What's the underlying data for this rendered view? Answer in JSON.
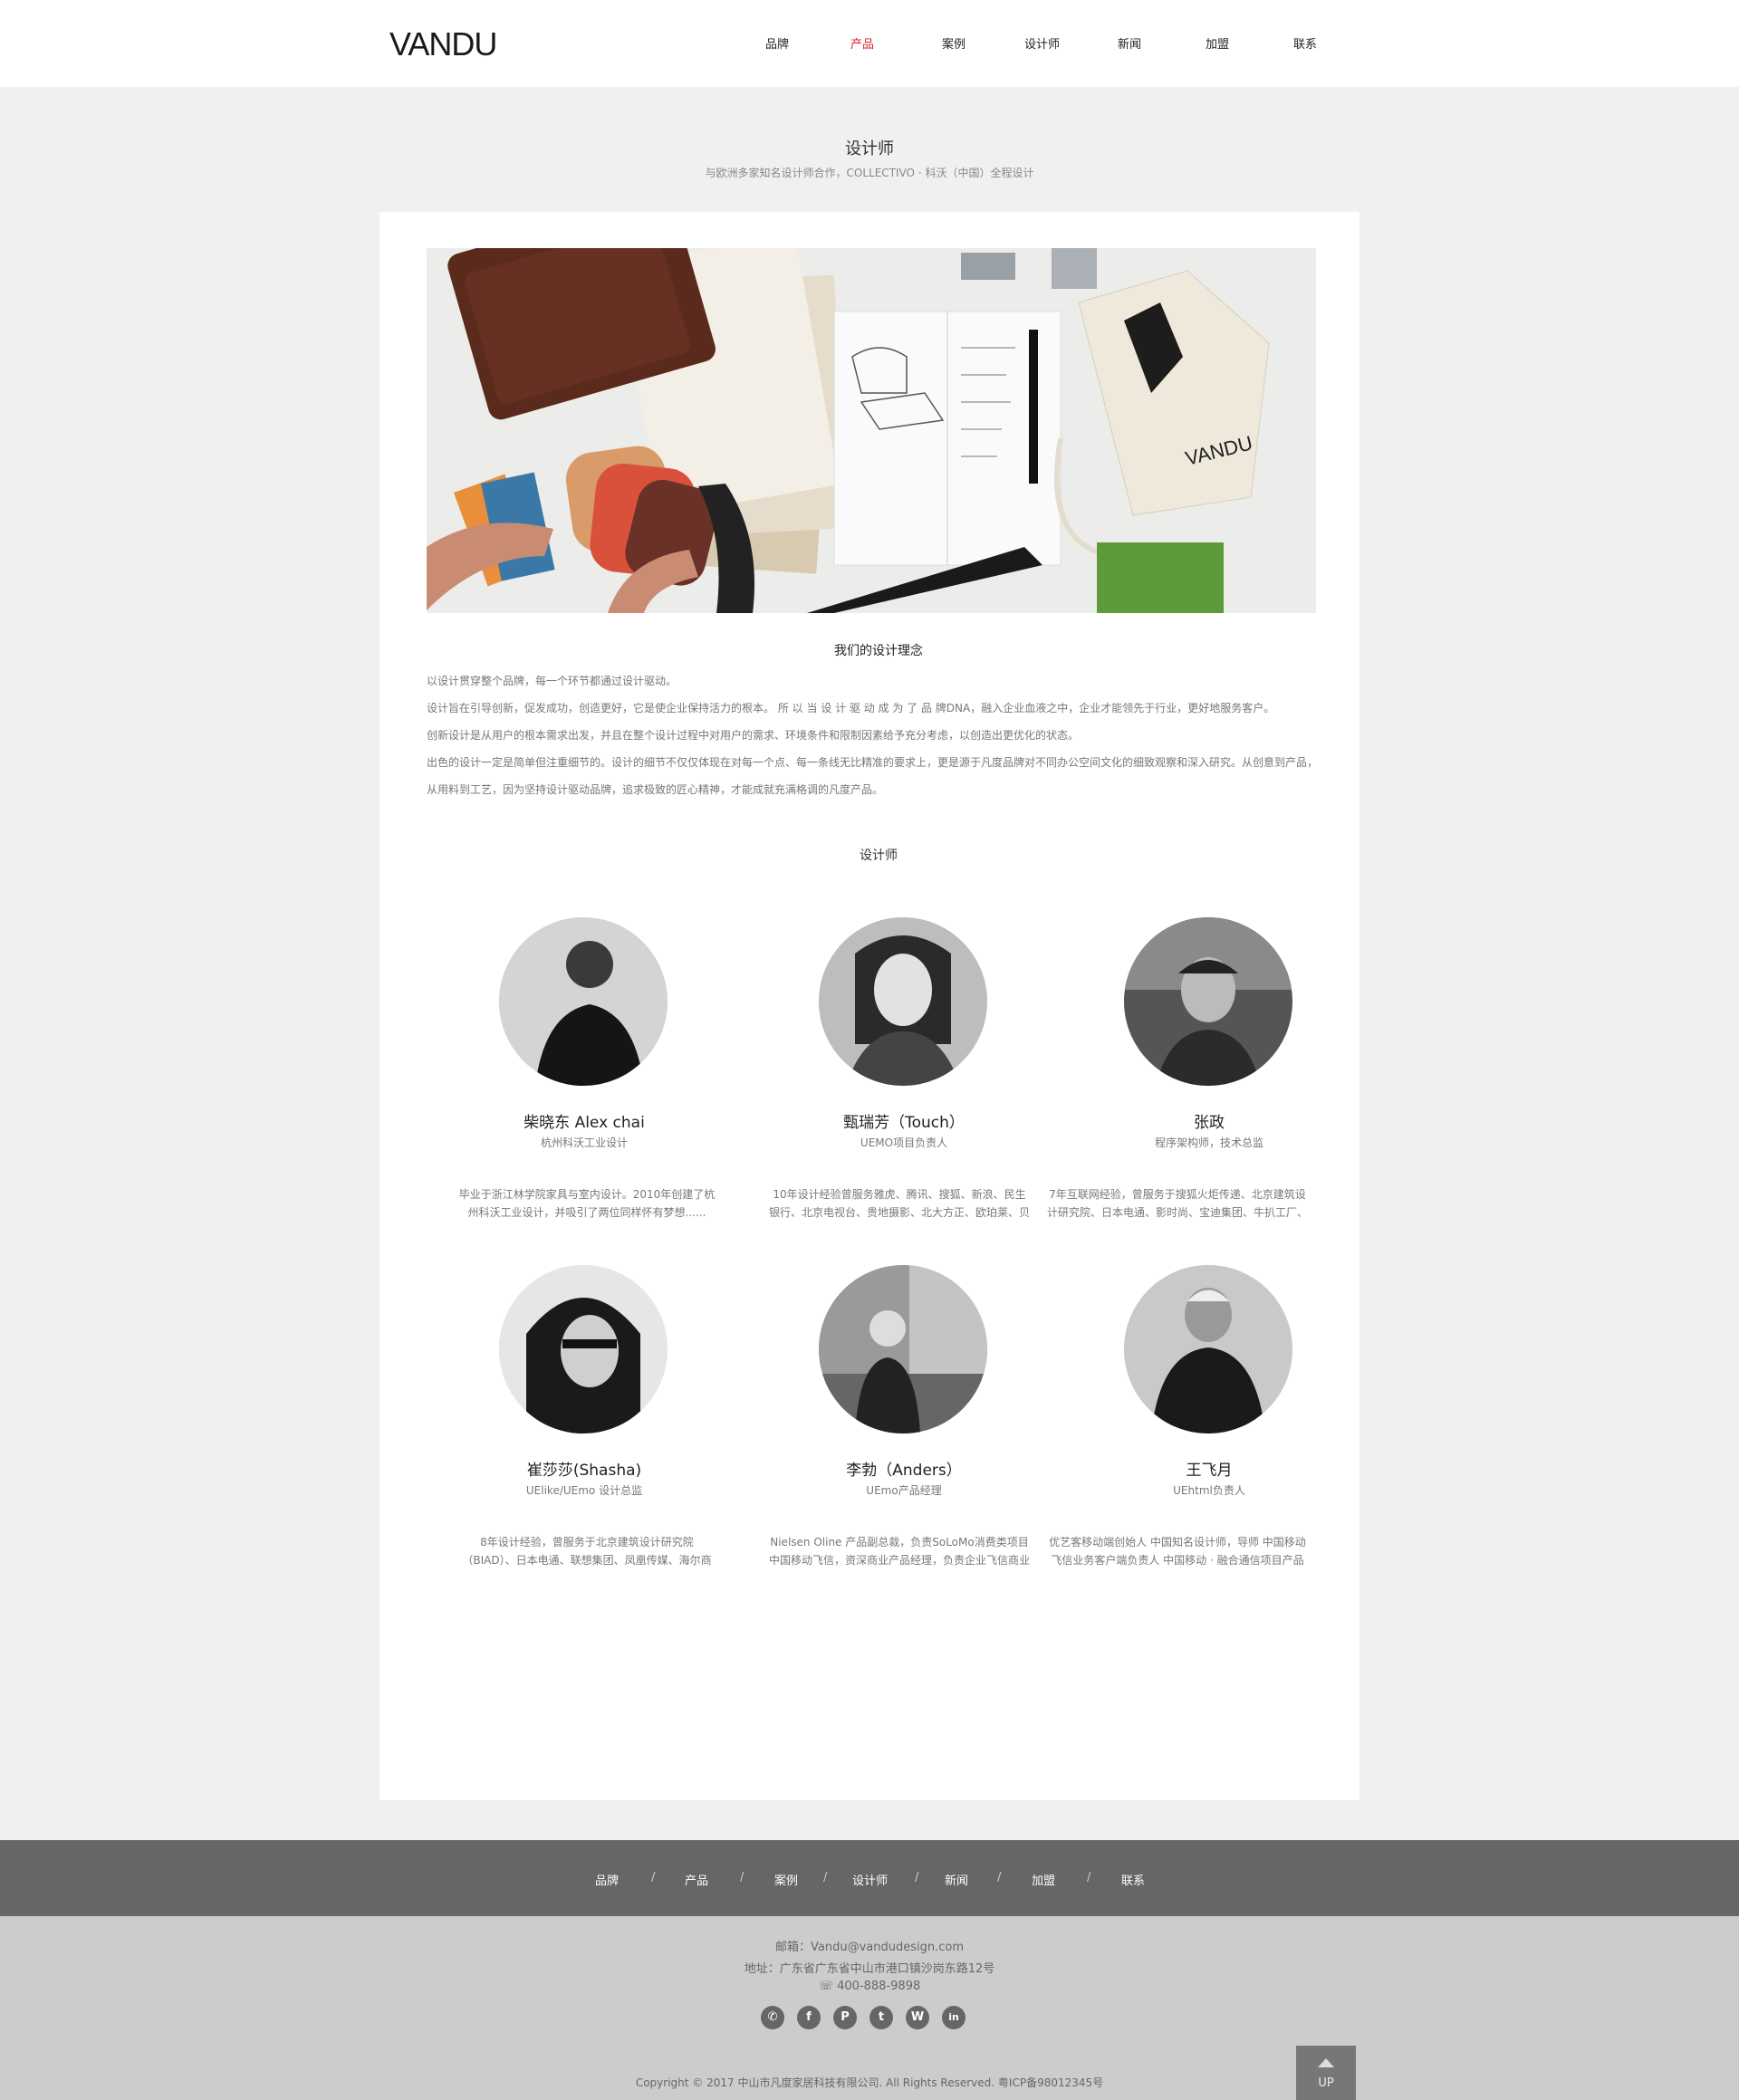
{
  "header": {
    "logo": "VANDU",
    "nav": [
      "品牌",
      "产品",
      "案例",
      "设计师",
      "新闻",
      "加盟",
      "联系"
    ],
    "active_index": 1
  },
  "page": {
    "title": "设计师",
    "subtitle": "与欧洲多家知名设计师合作，COLLECTIVO · 科沃（中国）全程设计"
  },
  "philosophy": {
    "title": "我们的设计理念",
    "paragraphs": [
      "以设计贯穿整个品牌，每一个环节都通过设计驱动。",
      "设计旨在引导创新，促发成功，创造更好，它是使企业保持活力的根本。 所 以 当 设 计 驱 动 成 为 了 品 牌DNA，融入企业血液之中，企业才能领先于行业，更好地服务客户。",
      "创新设计是从用户的根本需求出发，并且在整个设计过程中对用户的需求、环境条件和限制因素给予充分考虑，以创造出更优化的状态。",
      "出色的设计一定是简单但注重细节的。设计的细节不仅仅体现在对每一个点、每一条线无比精准的要求上，更是源于凡度品牌对不同办公空间文化的细致观察和深入研究。从创意到产品，从用料到工艺，因为坚持设计驱动品牌，追求极致的匠心精神，才能成就充满格调的凡度产品。"
    ]
  },
  "hero": {
    "logo_text": "VANDU"
  },
  "designers_title": "设计师",
  "designers": [
    {
      "name": "柴晓东 Alex chai",
      "role": "杭州科沃工业设计",
      "bio": "毕业于浙江林学院家具与室内设计。2010年创建了杭州科沃工业设计，并吸引了两位同样怀有梦想......"
    },
    {
      "name": "甄瑞芳（Touch）",
      "role": "UEMO项目负责人",
      "bio": "10年设计经验曾服务雅虎、腾讯、搜狐、新浪、民生银行、北京电视台、贵地摄影、北大方正、欧珀莱、贝玲"
    },
    {
      "name": "张政",
      "role": "程序架构师，技术总监",
      "bio": "7年互联网经验，曾服务于搜狐火炬传递、北京建筑设计研究院、日本电通、影时尚、宝迪集团、牛扒工厂、悠"
    },
    {
      "name": "崔莎莎(Shasha)",
      "role": "UElike/UEmo 设计总监",
      "bio": "8年设计经验，曾服务于北京建筑设计研究院（BIAD）、日本电通、联想集团、凤凰传媒、海尔商"
    },
    {
      "name": "李勃（Anders）",
      "role": "UEmo产品经理",
      "bio": "Nielsen Oline 产品副总裁，负责SoLoMo消费类项目 中国移动飞信，资深商业产品经理，负责企业飞信商业化"
    },
    {
      "name": "王飞月",
      "role": "UEhtml负责人",
      "bio": "优艺客移动端创始人 中国知名设计师，导师 中国移动飞信业务客户端负责人 中国移动 · 融合通信项目产品负责"
    }
  ],
  "footer_nav": [
    "品牌",
    "产品",
    "案例",
    "设计师",
    "新闻",
    "加盟",
    "联系"
  ],
  "footer_sep": "/",
  "footer": {
    "email": "邮箱：Vandu@vandudesign.com",
    "address": "地址：广东省广东省中山市港口镇沙岗东路12号",
    "phone": "400-888-9898",
    "socials": [
      "wechat-icon",
      "facebook-icon",
      "pinterest-icon",
      "twitter-icon",
      "weibo-icon",
      "linkedin-icon"
    ],
    "social_glyphs": [
      "✆",
      "f",
      "P",
      "t",
      "W",
      "in"
    ],
    "copyright": "Copyright © 2017 中山市凡度家居科技有限公司. All Rights Reserved.    粤ICP备98012345号",
    "up_label": "UP"
  }
}
